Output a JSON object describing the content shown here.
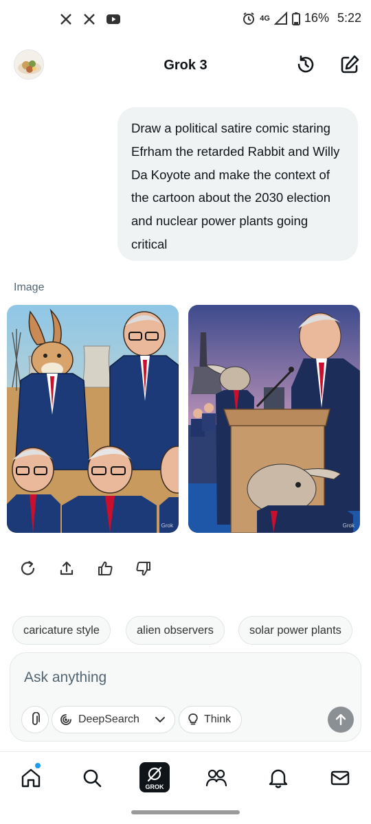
{
  "status_bar": {
    "left_icons": [
      "x-icon",
      "x-icon",
      "youtube-icon"
    ],
    "network_label": "4G",
    "battery": "16%",
    "time": "5:22"
  },
  "header": {
    "title": "Grok 3",
    "left_icon": "avatar",
    "right_icons": [
      "history-icon",
      "new-chat-icon"
    ]
  },
  "conversation": {
    "user_message": "Draw a political satire comic staring Efrham the retarded Rabbit and Willy Da Koyote and make the context of the cartoon about the 2030 election and nuclear power plants going critical",
    "response_label": "Image",
    "images": [
      {
        "watermark": "Grok"
      },
      {
        "watermark": "Grok"
      }
    ],
    "actions": [
      "regenerate-icon",
      "share-icon",
      "thumbs-up-icon",
      "thumbs-down-icon"
    ]
  },
  "suggestions": [
    "caricature style",
    "alien observers",
    "solar power plants"
  ],
  "composer": {
    "placeholder": "Ask anything",
    "deepsearch_label": "DeepSearch",
    "think_label": "Think"
  },
  "bottom_nav": {
    "items": [
      "home-icon",
      "search-icon",
      "grok-icon",
      "communities-icon",
      "notifications-icon",
      "messages-icon"
    ],
    "grok_label": "GROK",
    "accent": "#1d9bf0"
  }
}
